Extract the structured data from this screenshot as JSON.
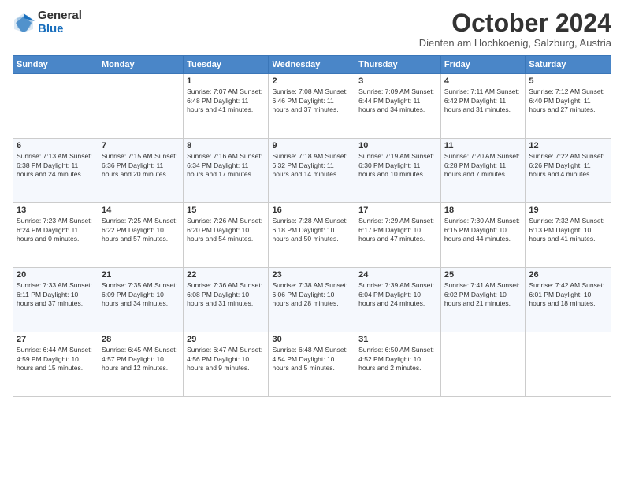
{
  "logo": {
    "general": "General",
    "blue": "Blue"
  },
  "header": {
    "title": "October 2024",
    "subtitle": "Dienten am Hochkoenig, Salzburg, Austria"
  },
  "days_of_week": [
    "Sunday",
    "Monday",
    "Tuesday",
    "Wednesday",
    "Thursday",
    "Friday",
    "Saturday"
  ],
  "weeks": [
    [
      {
        "day": "",
        "info": ""
      },
      {
        "day": "",
        "info": ""
      },
      {
        "day": "1",
        "info": "Sunrise: 7:07 AM\nSunset: 6:48 PM\nDaylight: 11 hours and 41 minutes."
      },
      {
        "day": "2",
        "info": "Sunrise: 7:08 AM\nSunset: 6:46 PM\nDaylight: 11 hours and 37 minutes."
      },
      {
        "day": "3",
        "info": "Sunrise: 7:09 AM\nSunset: 6:44 PM\nDaylight: 11 hours and 34 minutes."
      },
      {
        "day": "4",
        "info": "Sunrise: 7:11 AM\nSunset: 6:42 PM\nDaylight: 11 hours and 31 minutes."
      },
      {
        "day": "5",
        "info": "Sunrise: 7:12 AM\nSunset: 6:40 PM\nDaylight: 11 hours and 27 minutes."
      }
    ],
    [
      {
        "day": "6",
        "info": "Sunrise: 7:13 AM\nSunset: 6:38 PM\nDaylight: 11 hours and 24 minutes."
      },
      {
        "day": "7",
        "info": "Sunrise: 7:15 AM\nSunset: 6:36 PM\nDaylight: 11 hours and 20 minutes."
      },
      {
        "day": "8",
        "info": "Sunrise: 7:16 AM\nSunset: 6:34 PM\nDaylight: 11 hours and 17 minutes."
      },
      {
        "day": "9",
        "info": "Sunrise: 7:18 AM\nSunset: 6:32 PM\nDaylight: 11 hours and 14 minutes."
      },
      {
        "day": "10",
        "info": "Sunrise: 7:19 AM\nSunset: 6:30 PM\nDaylight: 11 hours and 10 minutes."
      },
      {
        "day": "11",
        "info": "Sunrise: 7:20 AM\nSunset: 6:28 PM\nDaylight: 11 hours and 7 minutes."
      },
      {
        "day": "12",
        "info": "Sunrise: 7:22 AM\nSunset: 6:26 PM\nDaylight: 11 hours and 4 minutes."
      }
    ],
    [
      {
        "day": "13",
        "info": "Sunrise: 7:23 AM\nSunset: 6:24 PM\nDaylight: 11 hours and 0 minutes."
      },
      {
        "day": "14",
        "info": "Sunrise: 7:25 AM\nSunset: 6:22 PM\nDaylight: 10 hours and 57 minutes."
      },
      {
        "day": "15",
        "info": "Sunrise: 7:26 AM\nSunset: 6:20 PM\nDaylight: 10 hours and 54 minutes."
      },
      {
        "day": "16",
        "info": "Sunrise: 7:28 AM\nSunset: 6:18 PM\nDaylight: 10 hours and 50 minutes."
      },
      {
        "day": "17",
        "info": "Sunrise: 7:29 AM\nSunset: 6:17 PM\nDaylight: 10 hours and 47 minutes."
      },
      {
        "day": "18",
        "info": "Sunrise: 7:30 AM\nSunset: 6:15 PM\nDaylight: 10 hours and 44 minutes."
      },
      {
        "day": "19",
        "info": "Sunrise: 7:32 AM\nSunset: 6:13 PM\nDaylight: 10 hours and 41 minutes."
      }
    ],
    [
      {
        "day": "20",
        "info": "Sunrise: 7:33 AM\nSunset: 6:11 PM\nDaylight: 10 hours and 37 minutes."
      },
      {
        "day": "21",
        "info": "Sunrise: 7:35 AM\nSunset: 6:09 PM\nDaylight: 10 hours and 34 minutes."
      },
      {
        "day": "22",
        "info": "Sunrise: 7:36 AM\nSunset: 6:08 PM\nDaylight: 10 hours and 31 minutes."
      },
      {
        "day": "23",
        "info": "Sunrise: 7:38 AM\nSunset: 6:06 PM\nDaylight: 10 hours and 28 minutes."
      },
      {
        "day": "24",
        "info": "Sunrise: 7:39 AM\nSunset: 6:04 PM\nDaylight: 10 hours and 24 minutes."
      },
      {
        "day": "25",
        "info": "Sunrise: 7:41 AM\nSunset: 6:02 PM\nDaylight: 10 hours and 21 minutes."
      },
      {
        "day": "26",
        "info": "Sunrise: 7:42 AM\nSunset: 6:01 PM\nDaylight: 10 hours and 18 minutes."
      }
    ],
    [
      {
        "day": "27",
        "info": "Sunrise: 6:44 AM\nSunset: 4:59 PM\nDaylight: 10 hours and 15 minutes."
      },
      {
        "day": "28",
        "info": "Sunrise: 6:45 AM\nSunset: 4:57 PM\nDaylight: 10 hours and 12 minutes."
      },
      {
        "day": "29",
        "info": "Sunrise: 6:47 AM\nSunset: 4:56 PM\nDaylight: 10 hours and 9 minutes."
      },
      {
        "day": "30",
        "info": "Sunrise: 6:48 AM\nSunset: 4:54 PM\nDaylight: 10 hours and 5 minutes."
      },
      {
        "day": "31",
        "info": "Sunrise: 6:50 AM\nSunset: 4:52 PM\nDaylight: 10 hours and 2 minutes."
      },
      {
        "day": "",
        "info": ""
      },
      {
        "day": "",
        "info": ""
      }
    ]
  ]
}
